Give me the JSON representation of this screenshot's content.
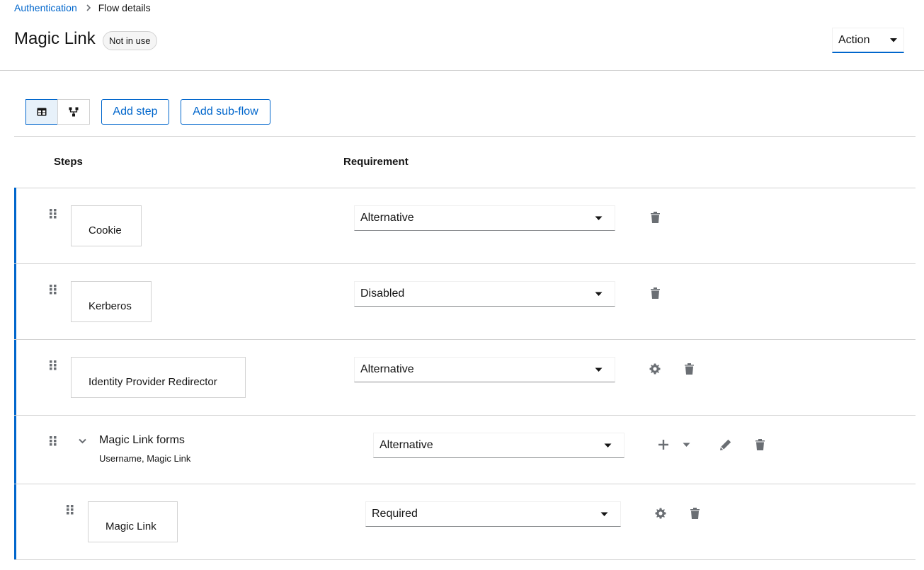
{
  "breadcrumb": {
    "parent": "Authentication",
    "current": "Flow details"
  },
  "header": {
    "title": "Magic Link",
    "status_label": "Not in use",
    "action_label": "Action"
  },
  "toolbar": {
    "add_step": "Add step",
    "add_subflow": "Add sub-flow",
    "view_modes": [
      "table-view-icon",
      "diagram-view-icon"
    ],
    "active_view": "table"
  },
  "table": {
    "columns": [
      "Steps",
      "Requirement"
    ],
    "rows": [
      {
        "name": "Cookie",
        "requirement": "Alternative",
        "actions": [
          "delete"
        ]
      },
      {
        "name": "Kerberos",
        "requirement": "Disabled",
        "actions": [
          "delete"
        ]
      },
      {
        "name": "Identity Provider Redirector",
        "requirement": "Alternative",
        "actions": [
          "settings",
          "delete"
        ]
      },
      {
        "name": "Magic Link forms",
        "description": "Username, Magic Link",
        "requirement": "Alternative",
        "type": "sub-flow",
        "expanded": true,
        "actions": [
          "add",
          "edit",
          "delete"
        ]
      },
      {
        "name": "Magic Link",
        "requirement": "Required",
        "nested": true,
        "actions": [
          "settings",
          "delete"
        ]
      }
    ]
  },
  "colors": {
    "accent": "#0066cc",
    "border": "#d2d2d2",
    "icon": "#6a6e73"
  }
}
